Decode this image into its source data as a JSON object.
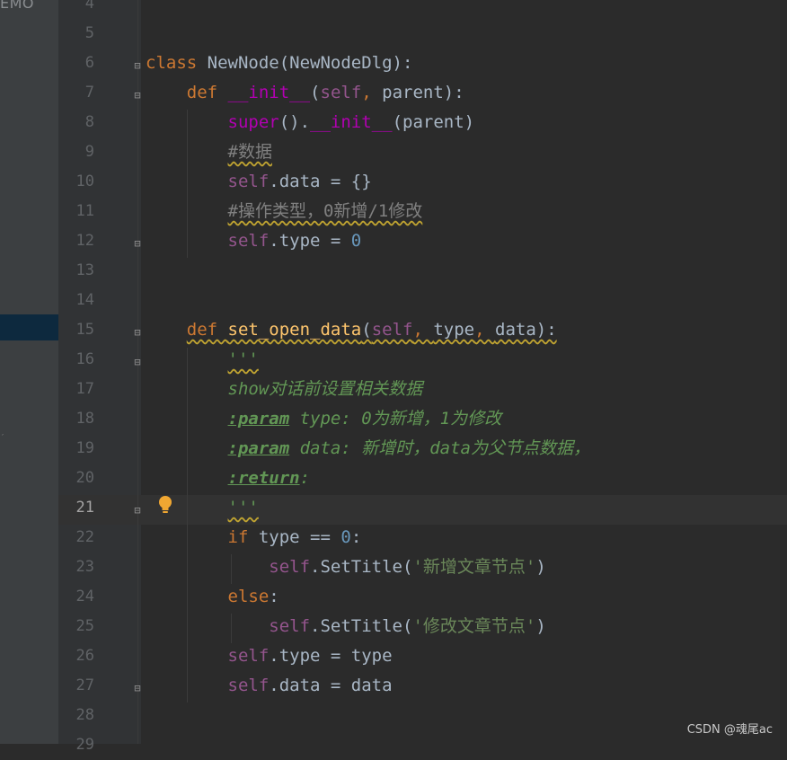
{
  "sidebar": {
    "label": "EMO"
  },
  "editor": {
    "current_line": "21",
    "line_numbers": [
      "4",
      "5",
      "6",
      "7",
      "8",
      "9",
      "10",
      "11",
      "12",
      "13",
      "14",
      "15",
      "16",
      "17",
      "18",
      "19",
      "20",
      "21",
      "22",
      "23",
      "24",
      "25",
      "26",
      "27",
      "28",
      "29"
    ],
    "lines": [
      {
        "segments": []
      },
      {
        "segments": []
      },
      {
        "segments": [
          {
            "text": "class ",
            "cls": "kw"
          },
          {
            "text": "NewNode",
            "cls": ""
          },
          {
            "text": "(NewNodeDlg):",
            "cls": ""
          }
        ]
      },
      {
        "segments": [
          {
            "text": "    ",
            "cls": ""
          },
          {
            "text": "def ",
            "cls": "kw"
          },
          {
            "text": "__init__",
            "cls": "mg"
          },
          {
            "text": "(",
            "cls": ""
          },
          {
            "text": "self",
            "cls": "sf"
          },
          {
            "text": ", ",
            "cls": "kw"
          },
          {
            "text": "parent):",
            "cls": ""
          }
        ]
      },
      {
        "segments": [
          {
            "text": "        ",
            "cls": ""
          },
          {
            "text": "super",
            "cls": "mg"
          },
          {
            "text": "().",
            "cls": ""
          },
          {
            "text": "__init__",
            "cls": "mg"
          },
          {
            "text": "(parent)",
            "cls": ""
          }
        ]
      },
      {
        "segments": [
          {
            "text": "        ",
            "cls": ""
          },
          {
            "text": "#数据",
            "cls": "cm wv"
          }
        ]
      },
      {
        "segments": [
          {
            "text": "        ",
            "cls": ""
          },
          {
            "text": "self",
            "cls": "sf"
          },
          {
            "text": ".data = {}",
            "cls": ""
          }
        ]
      },
      {
        "segments": [
          {
            "text": "        ",
            "cls": ""
          },
          {
            "text": "#操作类型，0新增/1修改",
            "cls": "cm wv"
          }
        ]
      },
      {
        "segments": [
          {
            "text": "        ",
            "cls": ""
          },
          {
            "text": "self",
            "cls": "sf"
          },
          {
            "text": ".type = ",
            "cls": ""
          },
          {
            "text": "0",
            "cls": "nm"
          }
        ]
      },
      {
        "segments": []
      },
      {
        "segments": []
      },
      {
        "segments": [
          {
            "text": "    ",
            "cls": ""
          },
          {
            "text": "def ",
            "cls": "kw wv"
          },
          {
            "text": "set_open_data",
            "cls": "fn wv"
          },
          {
            "text": "(",
            "cls": "wv"
          },
          {
            "text": "self",
            "cls": "sf wv"
          },
          {
            "text": ", ",
            "cls": "kw wv"
          },
          {
            "text": "type",
            "cls": "wv"
          },
          {
            "text": ", ",
            "cls": "kw wv"
          },
          {
            "text": "data):",
            "cls": "wv"
          }
        ]
      },
      {
        "segments": [
          {
            "text": "        ",
            "cls": ""
          },
          {
            "text": "'''",
            "cls": "dc wv"
          }
        ]
      },
      {
        "segments": [
          {
            "text": "        ",
            "cls": ""
          },
          {
            "text": "show对话前设置相关数据",
            "cls": "dc"
          }
        ]
      },
      {
        "segments": [
          {
            "text": "        ",
            "cls": ""
          },
          {
            "text": ":param",
            "cls": "tg"
          },
          {
            "text": " type: 0为新增，1为修改",
            "cls": "dc"
          }
        ]
      },
      {
        "segments": [
          {
            "text": "        ",
            "cls": ""
          },
          {
            "text": ":param",
            "cls": "tg"
          },
          {
            "text": " data: 新增时，data为父节点数据，",
            "cls": "dc"
          }
        ]
      },
      {
        "segments": [
          {
            "text": "        ",
            "cls": ""
          },
          {
            "text": ":return",
            "cls": "tg"
          },
          {
            "text": ":",
            "cls": "dc"
          }
        ]
      },
      {
        "segments": [
          {
            "text": "        ",
            "cls": ""
          },
          {
            "text": "'''",
            "cls": "dc wv"
          }
        ]
      },
      {
        "segments": [
          {
            "text": "        ",
            "cls": ""
          },
          {
            "text": "if ",
            "cls": "kw"
          },
          {
            "text": "type == ",
            "cls": ""
          },
          {
            "text": "0",
            "cls": "nm"
          },
          {
            "text": ":",
            "cls": ""
          }
        ]
      },
      {
        "segments": [
          {
            "text": "            ",
            "cls": ""
          },
          {
            "text": "self",
            "cls": "sf"
          },
          {
            "text": ".SetTitle(",
            "cls": ""
          },
          {
            "text": "'新增文章节点'",
            "cls": "st"
          },
          {
            "text": ")",
            "cls": ""
          }
        ]
      },
      {
        "segments": [
          {
            "text": "        ",
            "cls": ""
          },
          {
            "text": "else",
            "cls": "kw"
          },
          {
            "text": ":",
            "cls": ""
          }
        ]
      },
      {
        "segments": [
          {
            "text": "            ",
            "cls": ""
          },
          {
            "text": "self",
            "cls": "sf"
          },
          {
            "text": ".SetTitle(",
            "cls": ""
          },
          {
            "text": "'修改文章节点'",
            "cls": "st"
          },
          {
            "text": ")",
            "cls": ""
          }
        ]
      },
      {
        "segments": [
          {
            "text": "        ",
            "cls": ""
          },
          {
            "text": "self",
            "cls": "sf"
          },
          {
            "text": ".type = type",
            "cls": ""
          }
        ]
      },
      {
        "segments": [
          {
            "text": "        ",
            "cls": ""
          },
          {
            "text": "self",
            "cls": "sf"
          },
          {
            "text": ".data = data",
            "cls": ""
          }
        ]
      },
      {
        "segments": []
      },
      {
        "segments": []
      }
    ]
  },
  "icons": {
    "fold_open": "fold-open-icon",
    "fold_close": "fold-close-icon",
    "intention": "lightbulb-icon"
  },
  "colors": {
    "keyword": "#cc7832",
    "function": "#ffc66d",
    "magic": "#b200b2",
    "self": "#94558d",
    "number": "#6897bb",
    "comment": "#808080",
    "string": "#6a8759",
    "docstring": "#629755"
  },
  "watermark": "CSDN @魂尾ac"
}
